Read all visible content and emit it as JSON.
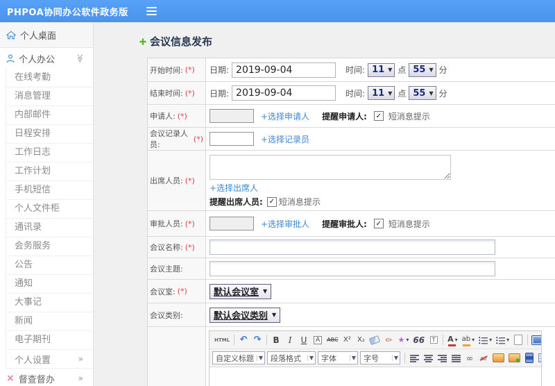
{
  "header": {
    "title": "PHPOA协同办公软件政务版"
  },
  "sidebar": {
    "desktop": "个人桌面",
    "office": "个人办公",
    "sub_items": [
      "在线考勤",
      "消息管理",
      "内部邮件",
      "日程安排",
      "工作日志",
      "工作计划",
      "手机短信",
      "个人文件柜",
      "通讯录",
      "会务服务",
      "公告",
      "通知",
      "大事记",
      "新闻",
      "电子期刊"
    ],
    "settings": "个人设置",
    "supervise": "督查督办"
  },
  "page": {
    "title": "会议信息发布"
  },
  "form": {
    "required": "(*)",
    "checkbox_glyph": "✓",
    "start_time": {
      "label": "开始时间:",
      "date_label": "日期:",
      "date_value": "2019-09-04",
      "time_label": "时间:",
      "hour": "11",
      "hour_unit": "点",
      "minute": "55",
      "minute_unit": "分"
    },
    "end_time": {
      "label": "结束时间:",
      "date_label": "日期:",
      "date_value": "2019-09-04",
      "time_label": "时间:",
      "hour": "11",
      "hour_unit": "点",
      "minute": "55",
      "minute_unit": "分"
    },
    "applicant": {
      "label": "申请人:",
      "link": "+选择申请人",
      "remind": "提醒申请人:",
      "sms": "短消息提示"
    },
    "recorder": {
      "label": "会议记录人员:",
      "link": "+选择记录员"
    },
    "attendees": {
      "label": "出席人员:",
      "link": "+选择出席人",
      "remind": "提醒出席人员:",
      "sms": "短消息提示"
    },
    "approver": {
      "label": "审批人员:",
      "link": "+选择审批人",
      "remind": "提醒审批人:",
      "sms": "短消息提示"
    },
    "meeting_name": {
      "label": "会议名称:"
    },
    "meeting_subject": {
      "label": "会议主题:"
    },
    "meeting_room": {
      "label": "会议室:",
      "value": "默认会议室"
    },
    "meeting_category": {
      "label": "会议类别:",
      "value": "默认会议类别"
    }
  },
  "editor": {
    "toolbar_row1": [
      {
        "name": "html-source",
        "glyph": "HTML"
      },
      {
        "sep": true
      },
      {
        "name": "undo",
        "glyph": "↶"
      },
      {
        "name": "redo",
        "glyph": "↷"
      },
      {
        "sep": true
      },
      {
        "name": "bold",
        "glyph": "B"
      },
      {
        "name": "italic",
        "glyph": "I"
      },
      {
        "name": "underline",
        "glyph": "U"
      },
      {
        "name": "font-style-box",
        "glyph": "A"
      },
      {
        "name": "strikethrough",
        "glyph": "ABC"
      },
      {
        "name": "superscript",
        "glyph": "X²"
      },
      {
        "name": "subscript",
        "glyph": "X₂"
      },
      {
        "name": "eraser",
        "shape": "eraser"
      },
      {
        "name": "format-brush",
        "glyph": "✏"
      },
      {
        "name": "auto-format",
        "glyph": "★",
        "arrow": true
      },
      {
        "name": "blockquote",
        "glyph": "66"
      },
      {
        "name": "paste-text",
        "glyph": "T"
      },
      {
        "sep": true
      },
      {
        "name": "font-color",
        "glyph": "A",
        "arrow": true,
        "bar": "#c43c35"
      },
      {
        "name": "highlight-color",
        "glyph": "ab",
        "arrow": true,
        "bar": "#e8a33d"
      },
      {
        "name": "ordered-list",
        "shape": "list-num",
        "arrow": true
      },
      {
        "name": "unordered-list",
        "shape": "list-dot",
        "arrow": true
      },
      {
        "name": "new-page",
        "shape": "doc"
      },
      {
        "sep": true
      },
      {
        "name": "fullscreen",
        "shape": "screen",
        "push": true
      }
    ],
    "toolbar_selects": [
      {
        "name": "custom-title-select",
        "label": "自定义标题"
      },
      {
        "name": "paragraph-format-select",
        "label": "段落格式"
      },
      {
        "name": "font-family-select",
        "label": "字体"
      },
      {
        "name": "font-size-select",
        "label": "字号"
      }
    ],
    "toolbar_row2": [
      {
        "name": "align-left",
        "shape": "align-left"
      },
      {
        "name": "align-center",
        "shape": "align-center"
      },
      {
        "name": "align-right",
        "shape": "align-right"
      },
      {
        "name": "align-justify",
        "shape": "align-justify"
      },
      {
        "name": "link",
        "glyph": "∞"
      },
      {
        "name": "unlink",
        "glyph": "∞",
        "slash": true
      },
      {
        "name": "insert-image",
        "shape": "img"
      },
      {
        "name": "upload-image",
        "shape": "img2"
      },
      {
        "name": "insert-media",
        "shape": "media"
      },
      {
        "name": "insert-table",
        "shape": "table"
      }
    ]
  }
}
